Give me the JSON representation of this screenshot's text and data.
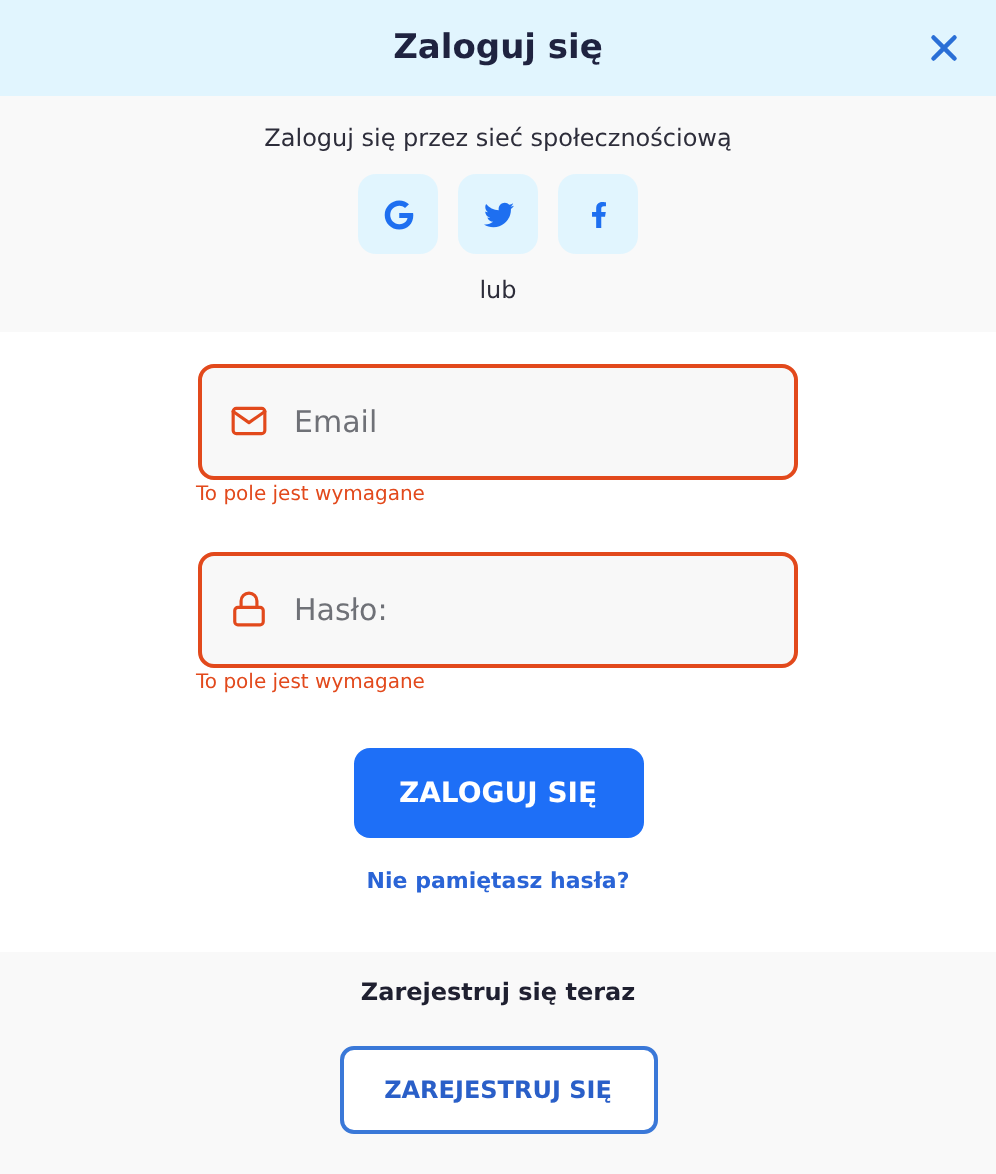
{
  "header": {
    "title": "Zaloguj się"
  },
  "social": {
    "label": "Zaloguj się przez sieć społecznościową",
    "buttons": [
      {
        "kind": "google"
      },
      {
        "kind": "twitter"
      },
      {
        "kind": "facebook"
      }
    ],
    "separator": "lub"
  },
  "fields": [
    {
      "kind": "email",
      "placeholder": "Email",
      "invalid": true,
      "error": "To pole jest wymagane"
    },
    {
      "kind": "password",
      "placeholder": "Hasło:",
      "invalid": true,
      "error": "To pole jest wymagane"
    }
  ],
  "submit": "ZALOGUJ SIĘ",
  "forgot_link": "Nie pamiętasz hasła?",
  "register": {
    "label": "Zarejestruj się teraz",
    "button": "ZAREJESTRUJ SIĘ"
  }
}
